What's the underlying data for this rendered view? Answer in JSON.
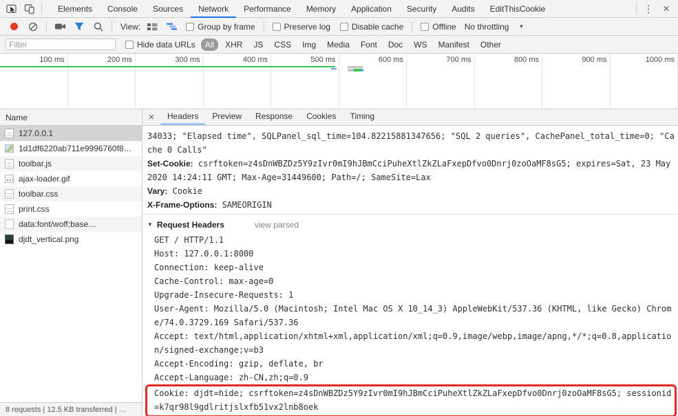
{
  "tabbar": {
    "tabs": [
      {
        "label": "Elements"
      },
      {
        "label": "Console"
      },
      {
        "label": "Sources"
      },
      {
        "label": "Network",
        "selected": true
      },
      {
        "label": "Performance"
      },
      {
        "label": "Memory"
      },
      {
        "label": "Application"
      },
      {
        "label": "Security"
      },
      {
        "label": "Audits"
      },
      {
        "label": "EditThisCookie"
      }
    ]
  },
  "toolbar": {
    "view_label": "View:",
    "group_by_frame": "Group by frame",
    "preserve_log": "Preserve log",
    "disable_cache": "Disable cache",
    "offline": "Offline",
    "throttling": "No throttling"
  },
  "filterbar": {
    "placeholder": "Filter",
    "hide_data_urls": "Hide data URLs",
    "types": [
      {
        "label": "All",
        "selected": true
      },
      {
        "label": "XHR"
      },
      {
        "label": "JS"
      },
      {
        "label": "CSS"
      },
      {
        "label": "Img"
      },
      {
        "label": "Media"
      },
      {
        "label": "Font"
      },
      {
        "label": "Doc"
      },
      {
        "label": "WS"
      },
      {
        "label": "Manifest"
      },
      {
        "label": "Other"
      }
    ]
  },
  "overview": {
    "ticks": [
      "100 ms",
      "200 ms",
      "300 ms",
      "400 ms",
      "500 ms",
      "600 ms",
      "700 ms",
      "800 ms",
      "900 ms",
      "1000 ms"
    ]
  },
  "requests": {
    "column_header": "Name",
    "items": [
      {
        "label": "127.0.0.1",
        "icon": "doc",
        "selected": true
      },
      {
        "label": "1d1df6220ab711e9996760f8…",
        "icon": "img"
      },
      {
        "label": "toolbar.js",
        "icon": "doc"
      },
      {
        "label": "ajax-loader.gif",
        "icon": "loader"
      },
      {
        "label": "toolbar.css",
        "icon": "doc"
      },
      {
        "label": "print.css",
        "icon": "doc"
      },
      {
        "label": "data:font/woff;base…",
        "icon": "plain"
      },
      {
        "label": "djdt_vertical.png",
        "icon": "img-dark"
      }
    ]
  },
  "details": {
    "tabs": [
      {
        "label": "Headers",
        "selected": true
      },
      {
        "label": "Preview"
      },
      {
        "label": "Response"
      },
      {
        "label": "Cookies"
      },
      {
        "label": "Timing"
      }
    ],
    "response_overflow": "34033; \"Elapsed time\", SQLPanel_sql_time=104.82215881347656; \"SQL 2 queries\", CachePanel_total_time=0; \"Cache 0 Calls\"",
    "response_headers": [
      {
        "name": "Set-Cookie:",
        "value": "csrftoken=z4sDnWBZDz5Y9zIvr0mI9hJBmCciPuheXtlZkZLaFxepDfvo0Dnrj0zoOaMF8sG5; expires=Sat, 23 May 2020 14:24:11 GMT; Max-Age=31449600; Path=/; SameSite=Lax"
      },
      {
        "name": "Vary:",
        "value": "Cookie"
      },
      {
        "name": "X-Frame-Options:",
        "value": "SAMEORIGIN"
      }
    ],
    "request_headers_title": "Request Headers",
    "view_parsed": "view parsed",
    "request_lines": [
      "GET / HTTP/1.1",
      "Host: 127.0.0.1:8000",
      "Connection: keep-alive",
      "Cache-Control: max-age=0",
      "Upgrade-Insecure-Requests: 1",
      "User-Agent: Mozilla/5.0 (Macintosh; Intel Mac OS X 10_14_3) AppleWebKit/537.36 (KHTML, like Gecko) Chrome/74.0.3729.169 Safari/537.36",
      "Accept: text/html,application/xhtml+xml,application/xml;q=0.9,image/webp,image/apng,*/*;q=0.8,application/signed-exchange;v=b3",
      "Accept-Encoding: gzip, deflate, br",
      "Accept-Language: zh-CN,zh;q=0.9"
    ],
    "cookie_line": "Cookie: djdt=hide; csrftoken=z4sDnWBZDz5Y9zIvr0mI9hJBmCciPuheXtlZkZLaFxepDfvo0Dnrj0zoOaMF8sG5; sessionid=k7qr98l9gdlritjslxfb51vx2lnb8oek"
  },
  "status_bar": {
    "text": "8 requests | 12.5 KB transferred | …"
  },
  "colors": {
    "accent_blue": "#1a73e8",
    "record_red": "#e5392b",
    "highlight_red": "#e22a24",
    "event_green": "#3bc454",
    "selected_row_gray": "#d4d4d4",
    "toolbar_bg": "#f3f3f3"
  }
}
